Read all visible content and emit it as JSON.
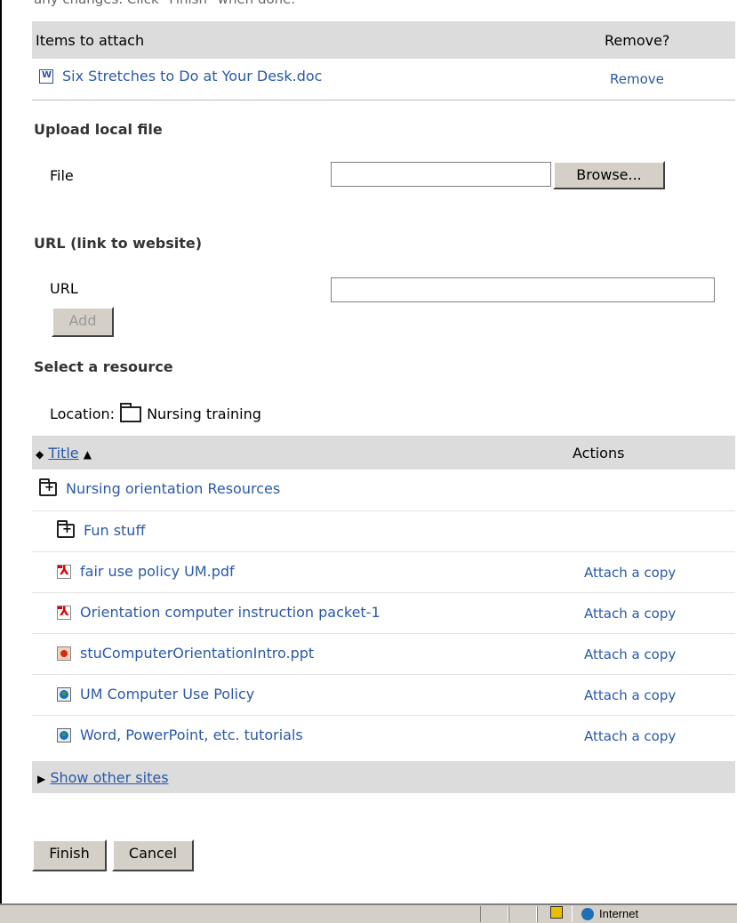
{
  "top_cut_text": "any changes. Click \"Finish\" when done.",
  "attach": {
    "col_items": "Items to attach",
    "col_remove": "Remove?",
    "items": [
      {
        "name": "Six Stretches to Do at Your Desk.doc",
        "icon": "word-doc-icon",
        "remove": "Remove"
      }
    ]
  },
  "upload": {
    "title": "Upload local file",
    "file_label": "File",
    "file_value": "",
    "browse_label": "Browse..."
  },
  "url": {
    "title": "URL (link to website)",
    "url_label": "URL",
    "url_value": "",
    "add_label": "Add"
  },
  "resource": {
    "title": "Select a resource",
    "location_label": "Location:",
    "location_name": "Nursing training",
    "col_title": "Title",
    "col_actions": "Actions",
    "rows": [
      {
        "name": "Nursing orientation Resources",
        "icon": "folder-expand-icon",
        "action": ""
      },
      {
        "name": "Fun stuff",
        "icon": "folder-expand-icon",
        "action": ""
      },
      {
        "name": "fair use policy UM.pdf",
        "icon": "pdf-icon",
        "action": "Attach a copy"
      },
      {
        "name": "Orientation computer instruction packet-1",
        "icon": "pdf-icon",
        "action": "Attach a copy"
      },
      {
        "name": "stuComputerOrientationIntro.ppt",
        "icon": "ppt-icon",
        "action": "Attach a copy"
      },
      {
        "name": "UM Computer Use Policy",
        "icon": "web-link-icon",
        "action": "Attach a copy"
      },
      {
        "name": "Word, PowerPoint, etc. tutorials",
        "icon": "web-link-icon",
        "action": "Attach a copy"
      }
    ],
    "show_other_sites": "Show other sites"
  },
  "buttons": {
    "finish": "Finish",
    "cancel": "Cancel"
  },
  "status": {
    "zone": "Internet"
  }
}
